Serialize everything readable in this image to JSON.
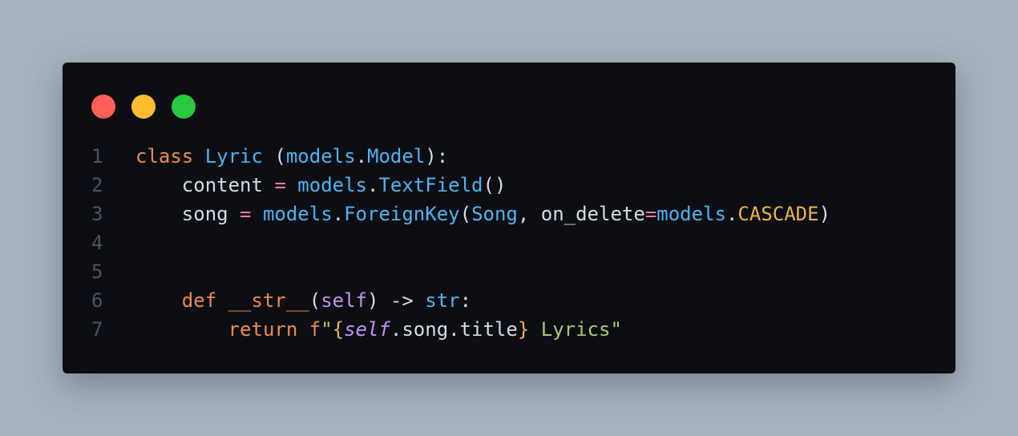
{
  "window": {
    "controls": [
      {
        "name": "close",
        "color": "#ff5f57"
      },
      {
        "name": "minimize",
        "color": "#febc2e"
      },
      {
        "name": "maximize",
        "color": "#28c840"
      }
    ]
  },
  "colors": {
    "background": "#a6b1bd",
    "editor_background": "#0c0e14",
    "keyword": "#ee8a4a",
    "identifier": "#4fb3ef",
    "operator": "#f07aa2",
    "self": "#c592ef",
    "constant": "#f0b34a",
    "string": "#a3cc6a",
    "plain": "#d7dae0",
    "line_number": "#4b5263"
  },
  "code": {
    "lines": [
      {
        "number": "1",
        "tokens": [
          {
            "t": "class",
            "c": "kw"
          },
          {
            "t": " ",
            "c": "pl"
          },
          {
            "t": "Lyric",
            "c": "fn"
          },
          {
            "t": " (",
            "c": "pl"
          },
          {
            "t": "models",
            "c": "fn"
          },
          {
            "t": ".",
            "c": "pl"
          },
          {
            "t": "Model",
            "c": "fn"
          },
          {
            "t": "):",
            "c": "pl"
          }
        ]
      },
      {
        "number": "2",
        "tokens": [
          {
            "t": "    content ",
            "c": "pl"
          },
          {
            "t": "=",
            "c": "op"
          },
          {
            "t": " ",
            "c": "pl"
          },
          {
            "t": "models",
            "c": "fn"
          },
          {
            "t": ".",
            "c": "pl"
          },
          {
            "t": "TextField",
            "c": "fn"
          },
          {
            "t": "()",
            "c": "pl"
          }
        ]
      },
      {
        "number": "3",
        "tokens": [
          {
            "t": "    song ",
            "c": "pl"
          },
          {
            "t": "=",
            "c": "op"
          },
          {
            "t": " ",
            "c": "pl"
          },
          {
            "t": "models",
            "c": "fn"
          },
          {
            "t": ".",
            "c": "pl"
          },
          {
            "t": "ForeignKey",
            "c": "fn"
          },
          {
            "t": "(",
            "c": "pl"
          },
          {
            "t": "Song",
            "c": "fn"
          },
          {
            "t": ", on_delete",
            "c": "pl"
          },
          {
            "t": "=",
            "c": "op"
          },
          {
            "t": "models",
            "c": "fn"
          },
          {
            "t": ".",
            "c": "pl"
          },
          {
            "t": "CASCADE",
            "c": "cst"
          },
          {
            "t": ")",
            "c": "pl"
          }
        ]
      },
      {
        "number": "4",
        "tokens": []
      },
      {
        "number": "5",
        "tokens": []
      },
      {
        "number": "6",
        "tokens": [
          {
            "t": "    ",
            "c": "pl"
          },
          {
            "t": "def",
            "c": "kw"
          },
          {
            "t": " __str__",
            "c": "kw"
          },
          {
            "t": "(",
            "c": "pl"
          },
          {
            "t": "self",
            "c": "slf"
          },
          {
            "t": ") -> ",
            "c": "pl"
          },
          {
            "t": "str",
            "c": "fn"
          },
          {
            "t": ":",
            "c": "pl"
          }
        ]
      },
      {
        "number": "7",
        "tokens": [
          {
            "t": "        ",
            "c": "pl"
          },
          {
            "t": "return",
            "c": "kw"
          },
          {
            "t": " ",
            "c": "pl"
          },
          {
            "t": "f",
            "c": "kw"
          },
          {
            "t": "\"",
            "c": "st"
          },
          {
            "t": "{",
            "c": "cst"
          },
          {
            "t": "self",
            "c": "slf it"
          },
          {
            "t": ".song.title",
            "c": "pl"
          },
          {
            "t": "}",
            "c": "cst"
          },
          {
            "t": " Lyrics\"",
            "c": "st"
          }
        ]
      }
    ]
  }
}
